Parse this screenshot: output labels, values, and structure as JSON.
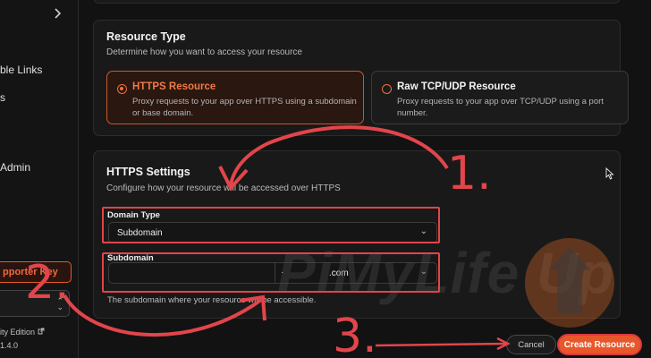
{
  "sidebar": {
    "items": [
      {
        "label": "ble Links"
      },
      {
        "label": "s"
      },
      {
        "label": "Admin"
      }
    ],
    "supporter_button": "pporter Key",
    "edition": "ity Edition",
    "version": "1.4.0"
  },
  "resource_type": {
    "title": "Resource Type",
    "description": "Determine how you want to access your resource",
    "options": [
      {
        "title": "HTTPS Resource",
        "description": "Proxy requests to your app over HTTPS using a subdomain or base domain.",
        "selected": true
      },
      {
        "title": "Raw TCP/UDP Resource",
        "description": "Proxy requests to your app over TCP/UDP using a port number.",
        "selected": false
      }
    ]
  },
  "https_settings": {
    "title": "HTTPS Settings",
    "description": "Configure how your resource will be accessed over HTTPS",
    "domain_type_label": "Domain Type",
    "domain_type_value": "Subdomain",
    "subdomain_label": "Subdomain",
    "subdomain_value": "",
    "domain_suffix": ".com",
    "subdomain_help": "The subdomain where your resource will be accessible."
  },
  "actions": {
    "cancel": "Cancel",
    "create": "Create Resource"
  },
  "annotations": {
    "step1": "1.",
    "step2": "2.",
    "step3": "3."
  },
  "watermark": "PiMyLife Up",
  "colors": {
    "accent": "#e8572a",
    "annotation": "#e2454b",
    "background": "#141414"
  }
}
